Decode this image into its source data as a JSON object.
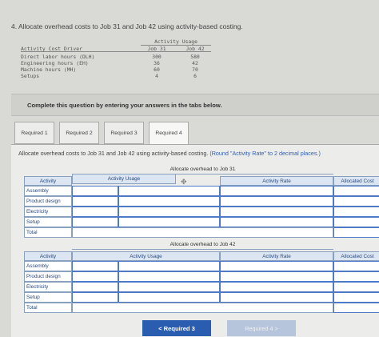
{
  "question": {
    "text": "4. Allocate overhead costs to Job 31 and Job 42 using activity-based costing."
  },
  "usage_table": {
    "group_header": "Activity Usage",
    "headers": [
      "Activity Cost Driver",
      "Job 31",
      "Job 42"
    ],
    "rows": [
      {
        "name": "Direct labor hours (DLH)",
        "job31": "300",
        "job42": "580"
      },
      {
        "name": "Engineering hours (EH)",
        "job31": "36",
        "job42": "42"
      },
      {
        "name": "Machine hours (MH)",
        "job31": "60",
        "job42": "70"
      },
      {
        "name": "Setups",
        "job31": "4",
        "job42": "6"
      }
    ]
  },
  "instruction": "Complete this question by entering your answers in the tabs below.",
  "tabs": [
    {
      "label": "Required 1"
    },
    {
      "label": "Required 2"
    },
    {
      "label": "Required 3"
    },
    {
      "label": "Required 4"
    }
  ],
  "panel": {
    "instruction": "Allocate overhead costs to Job 31 and Job 42 using activity-based costing.",
    "hint": "(Round \"Activity Rate\" to 2 decimal places.)"
  },
  "job31_table": {
    "title": "Allocate overhead to Job 31",
    "columns": [
      "Activity",
      "Activity Usage",
      "Activity Rate",
      "Allocated Cost"
    ],
    "rows": [
      "Assembly",
      "Product design",
      "Electricity",
      "Setup",
      "Total"
    ]
  },
  "job42_table": {
    "title": "Allocate overhead to Job 42",
    "columns": [
      "Activity",
      "Activity Usage",
      "Activity Rate",
      "Allocated Cost"
    ],
    "rows": [
      "Assembly",
      "Product design",
      "Electricity",
      "Setup",
      "Total"
    ]
  },
  "nav": {
    "prev_label": "< Required 3",
    "next_label": "Required 4 >"
  },
  "colors": {
    "primary_button": "#2a5db0",
    "disabled_button": "#b6c4dc",
    "table_header_bg": "#dce6f2",
    "hint_text": "#2f5fb3"
  }
}
